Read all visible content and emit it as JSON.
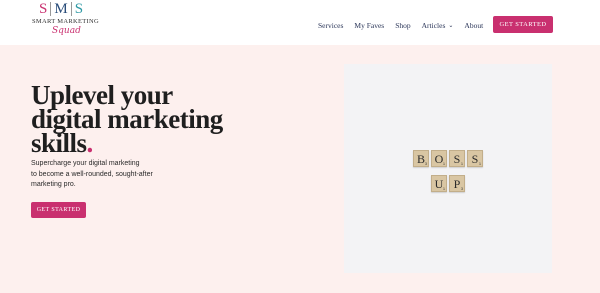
{
  "logo": {
    "letters": [
      "S",
      "M",
      "S"
    ],
    "line1": "SMART MARKETING",
    "line2": "Squad"
  },
  "nav": {
    "items": [
      {
        "label": "Services"
      },
      {
        "label": "My Faves"
      },
      {
        "label": "Shop"
      },
      {
        "label": "Articles",
        "has_dropdown": true
      },
      {
        "label": "About"
      }
    ],
    "cta_label": "GET STARTED"
  },
  "hero": {
    "headline_lines": [
      "Uplevel your",
      "digital marketing",
      "skills"
    ],
    "headline_dot": ".",
    "subtext_lines": [
      "Supercharge your digital marketing",
      "to become a well-rounded, sought-after",
      "marketing pro."
    ],
    "cta_label": "GET STARTED"
  },
  "image": {
    "row1": [
      {
        "letter": "B",
        "points": "3"
      },
      {
        "letter": "O",
        "points": "1"
      },
      {
        "letter": "S",
        "points": "1"
      },
      {
        "letter": "S",
        "points": "1"
      }
    ],
    "row2": [
      {
        "letter": "U",
        "points": "1"
      },
      {
        "letter": "P",
        "points": "3"
      }
    ]
  },
  "colors": {
    "accent": "#c9306f",
    "nav_text": "#2a3558",
    "hero_bg": "#fdf0ee",
    "photo_bg": "#f3f3f5",
    "tile": "#d9c6a3"
  }
}
